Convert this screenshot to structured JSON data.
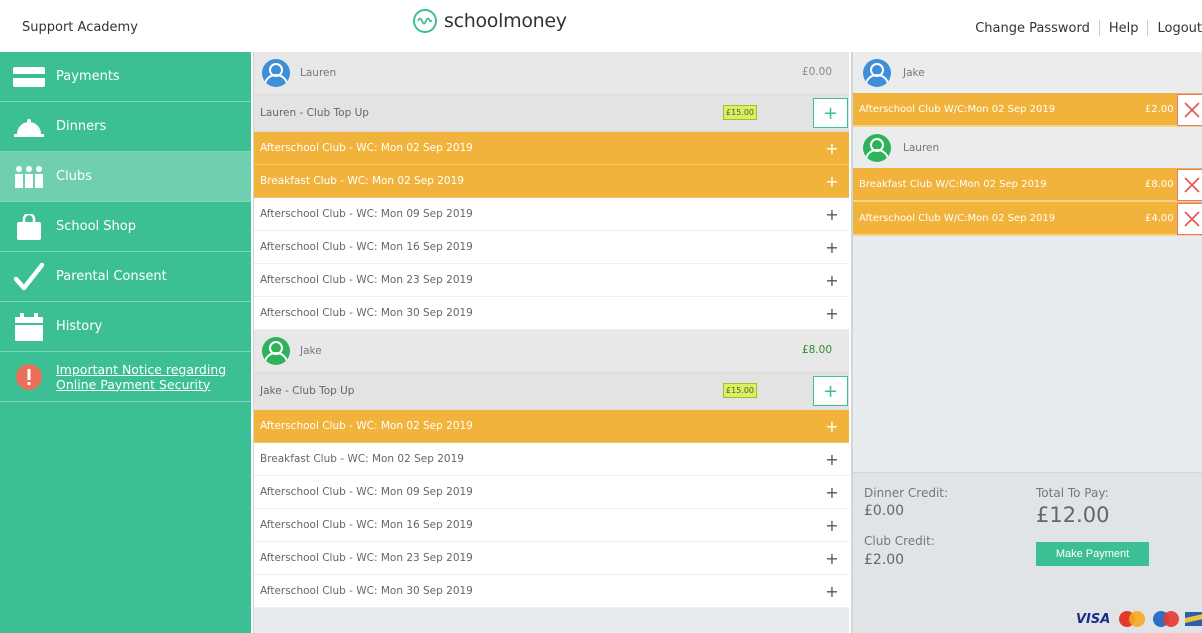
{
  "header": {
    "school_name": "Support Academy",
    "logo_text": "schoolmoney",
    "nav": [
      "Change Password",
      "Help",
      "Logout"
    ]
  },
  "sidebar": {
    "items": [
      {
        "label": "Payments",
        "icon": "credit-card-icon"
      },
      {
        "label": "Dinners",
        "icon": "cloche-icon"
      },
      {
        "label": "Clubs",
        "icon": "people-icon",
        "active": true
      },
      {
        "label": "School Shop",
        "icon": "shopping-bag-icon"
      },
      {
        "label": "Parental Consent",
        "icon": "checkmark-icon"
      },
      {
        "label": "History",
        "icon": "calendar-icon"
      }
    ],
    "notice": {
      "line1": "Important Notice regarding",
      "line2": "Online Payment Security",
      "icon": "alert-icon"
    }
  },
  "children": [
    {
      "name": "Lauren",
      "amount": "£0.00",
      "amount_color": "#888888",
      "topup_label": "Lauren - Club Top Up",
      "topup_value": "£15.00",
      "clubs": [
        {
          "label": "Afterschool Club - WC: Mon 02 Sep 2019",
          "selected": true
        },
        {
          "label": "Breakfast Club - WC: Mon 02 Sep 2019",
          "selected": true
        },
        {
          "label": "Afterschool Club - WC: Mon 09 Sep 2019",
          "selected": false
        },
        {
          "label": "Afterschool Club - WC: Mon 16 Sep 2019",
          "selected": false
        },
        {
          "label": "Afterschool Club - WC: Mon 23 Sep 2019",
          "selected": false
        },
        {
          "label": "Afterschool Club - WC: Mon 30 Sep 2019",
          "selected": false
        }
      ]
    },
    {
      "name": "Jake",
      "amount": "£8.00",
      "amount_color": "#2e8b2e",
      "topup_label": "Jake - Club Top Up",
      "topup_value": "£15.00",
      "clubs": [
        {
          "label": "Afterschool Club - WC: Mon 02 Sep 2019",
          "selected": true
        },
        {
          "label": "Breakfast Club - WC: Mon 02 Sep 2019",
          "selected": false
        },
        {
          "label": "Afterschool Club - WC: Mon 09 Sep 2019",
          "selected": false
        },
        {
          "label": "Afterschool Club - WC: Mon 16 Sep 2019",
          "selected": false
        },
        {
          "label": "Afterschool Club - WC: Mon 23 Sep 2019",
          "selected": false
        },
        {
          "label": "Afterschool Club - WC: Mon 30 Sep 2019",
          "selected": false
        }
      ]
    }
  ],
  "basket": {
    "groups": [
      {
        "name": "Jake",
        "items": [
          {
            "label": "Afterschool Club W/C:Mon 02 Sep 2019",
            "price": "£2.00"
          }
        ]
      },
      {
        "name": "Lauren",
        "items": [
          {
            "label": "Breakfast Club W/C:Mon 02 Sep 2019",
            "price": "£8.00"
          },
          {
            "label": "Afterschool Club W/C:Mon 02 Sep 2019",
            "price": "£4.00"
          }
        ]
      }
    ]
  },
  "totals": {
    "dinner_credit_label": "Dinner Credit:",
    "dinner_credit_value": "£0.00",
    "club_credit_label": "Club Credit:",
    "club_credit_value": "£2.00",
    "total_label": "Total To Pay:",
    "total_value": "£12.00",
    "pay_button": "Make Payment",
    "visa_text": "VISA"
  },
  "colors": {
    "brand": "#3cbf95",
    "selected": "#f1b33c",
    "remove": "#e05555"
  }
}
